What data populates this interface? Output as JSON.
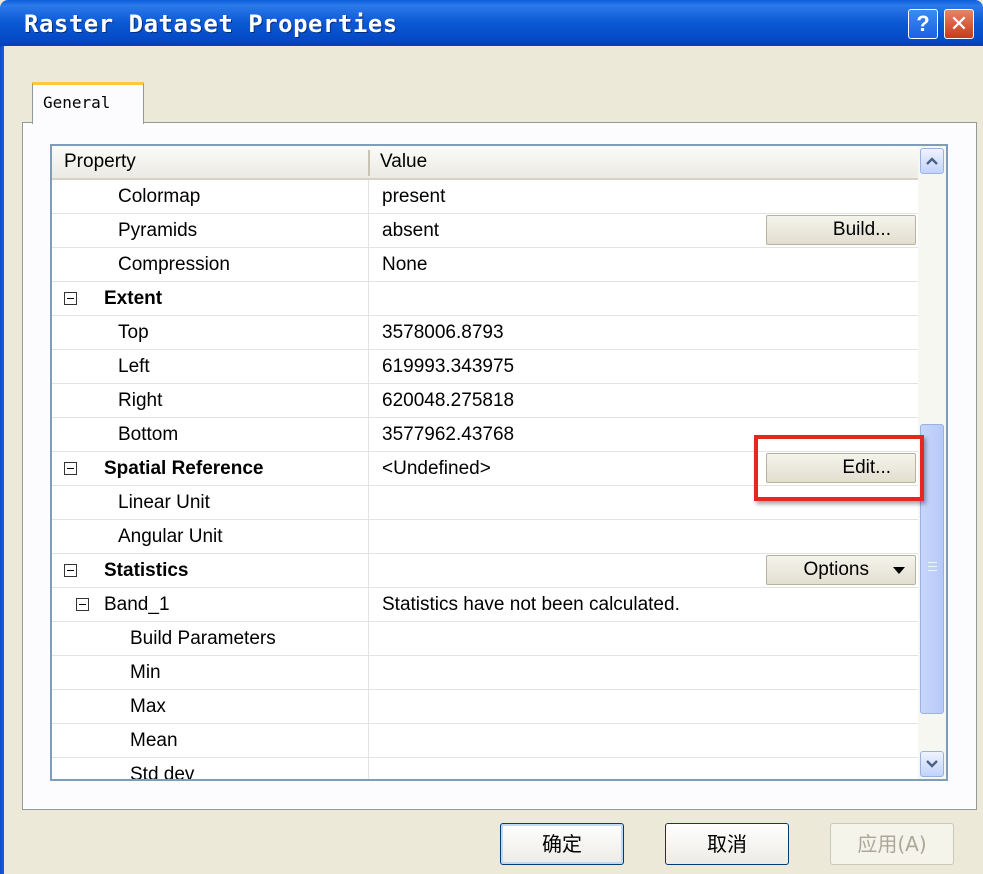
{
  "window": {
    "title": "Raster Dataset Properties",
    "help_glyph": "?",
    "close_glyph": "✕"
  },
  "tabs": [
    {
      "label": "General"
    }
  ],
  "grid": {
    "columns": {
      "property": "Property",
      "value": "Value"
    },
    "rows": [
      {
        "label": "Colormap",
        "value": "present"
      },
      {
        "label": "Pyramids",
        "value": "absent",
        "button": "Build..."
      },
      {
        "label": "Compression",
        "value": "None"
      },
      {
        "label": "Extent",
        "value": ""
      },
      {
        "label": "Top",
        "value": "3578006.8793"
      },
      {
        "label": "Left",
        "value": "619993.343975"
      },
      {
        "label": "Right",
        "value": "620048.275818"
      },
      {
        "label": "Bottom",
        "value": "3577962.43768"
      },
      {
        "label": "Spatial Reference",
        "value": "<Undefined>",
        "button": "Edit..."
      },
      {
        "label": "Linear Unit",
        "value": ""
      },
      {
        "label": "Angular Unit",
        "value": ""
      },
      {
        "label": "Statistics",
        "value": "",
        "button": "Options"
      },
      {
        "label": "Band_1",
        "value": "Statistics have not been calculated."
      },
      {
        "label": "Build Parameters",
        "value": ""
      },
      {
        "label": "Min",
        "value": ""
      },
      {
        "label": "Max",
        "value": ""
      },
      {
        "label": "Mean",
        "value": ""
      },
      {
        "label": "Std dev",
        "value": ""
      }
    ]
  },
  "buttons": {
    "ok": "确定",
    "cancel": "取消",
    "apply": "应用(A)"
  },
  "colors": {
    "title_bar": "#0a59d4",
    "highlight_box": "#e5271f",
    "dialog_bg": "#ece9d8"
  },
  "icons": [
    "help-icon",
    "close-icon",
    "collapse-icon",
    "dropdown-arrow-icon",
    "scroll-up-icon",
    "scroll-down-icon"
  ]
}
